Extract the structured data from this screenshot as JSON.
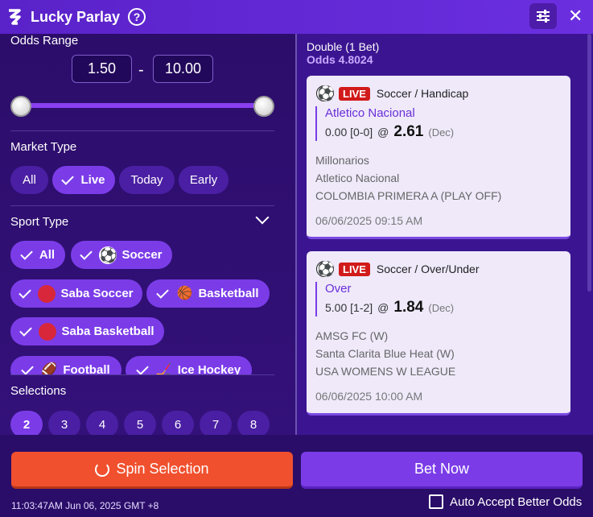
{
  "header": {
    "title": "Lucky Parlay",
    "help_icon": "?",
    "close_icon": "✕"
  },
  "filters": {
    "odds_range_label": "Odds Range",
    "odds_min": "1.50",
    "odds_max": "10.00",
    "dash": "-",
    "market_type_label": "Market Type",
    "market_types": [
      {
        "label": "All",
        "active": false
      },
      {
        "label": "Live",
        "active": true
      },
      {
        "label": "Today",
        "active": false
      },
      {
        "label": "Early",
        "active": false
      }
    ],
    "sport_type_label": "Sport Type",
    "sports": [
      {
        "label": "All",
        "icon": ""
      },
      {
        "label": "Soccer",
        "icon": "⚽"
      },
      {
        "label": "Saba Soccer",
        "icon": "saba-soccer-icon"
      },
      {
        "label": "Basketball",
        "icon": "🏀"
      },
      {
        "label": "Saba Basketball",
        "icon": "saba-basketball-icon"
      },
      {
        "label": "Football",
        "icon": "🏈"
      },
      {
        "label": "Ice Hockey",
        "icon": "🏒"
      }
    ],
    "selections_label": "Selections",
    "selections": [
      "2",
      "3",
      "4",
      "5",
      "6",
      "7",
      "8"
    ],
    "selected_count": "2"
  },
  "bet_slip": {
    "title": "Double (1 Bet)",
    "odds": "Odds 4.8024",
    "bets": [
      {
        "live": "LIVE",
        "market": "Soccer / Handicap",
        "selection": "Atletico Nacional",
        "line": "0.00 [0-0]",
        "at": "@",
        "price": "2.61",
        "odds_type": "(Dec)",
        "home": "Millonarios",
        "away": "Atletico Nacional",
        "league": "COLOMBIA PRIMERA A (PLAY OFF)",
        "time": "06/06/2025 09:15 AM"
      },
      {
        "live": "LIVE",
        "market": "Soccer / Over/Under",
        "selection": "Over",
        "line": "5.00 [1-2]",
        "at": "@",
        "price": "1.84",
        "odds_type": "(Dec)",
        "home": "AMSG FC (W)",
        "away": "Santa Clarita Blue Heat (W)",
        "league": "USA WOMENS W LEAGUE",
        "time": "06/06/2025 10:00 AM"
      }
    ]
  },
  "footer": {
    "spin_label": "Spin Selection",
    "bet_label": "Bet Now",
    "clock": "11:03:47AM Jun 06, 2025 GMT +8",
    "auto_accept_label": "Auto Accept Better Odds"
  },
  "colors": {
    "accent": "#7b3ce8",
    "spin": "#f0502e",
    "live": "#d11a1a"
  }
}
